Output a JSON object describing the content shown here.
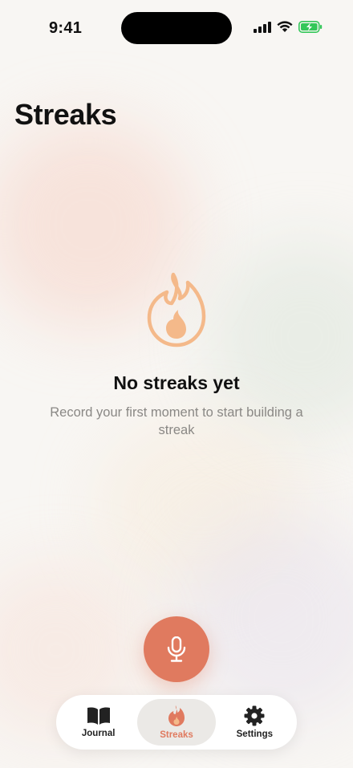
{
  "status_bar": {
    "time": "9:41",
    "icons": [
      "cellular-signal-icon",
      "wifi-icon",
      "battery-charging-icon"
    ]
  },
  "page": {
    "title": "Streaks"
  },
  "empty_state": {
    "icon": "flame-icon",
    "title": "No streaks yet",
    "subtitle": "Record your first moment to start building a streak"
  },
  "record_button": {
    "icon": "microphone-icon"
  },
  "tab_bar": {
    "tabs": [
      {
        "label": "Journal",
        "icon": "book-icon",
        "active": false
      },
      {
        "label": "Streaks",
        "icon": "flame-icon",
        "active": true
      },
      {
        "label": "Settings",
        "icon": "gear-icon",
        "active": false
      }
    ]
  },
  "colors": {
    "accent": "#e07a5f",
    "flame_outline": "#f4b98a",
    "background": "#f8f6f3",
    "battery_green": "#34c759"
  }
}
